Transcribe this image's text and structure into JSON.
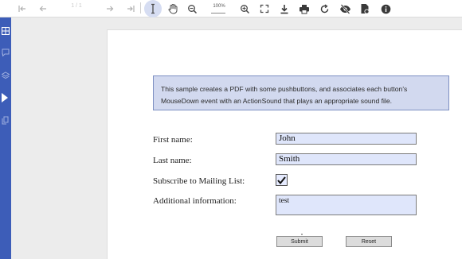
{
  "toolbar": {
    "page_number": "1 / 1",
    "zoom_level": "100%",
    "active_tool": "text-select",
    "icons": [
      "first-page-icon",
      "previous-page-icon",
      "next-page-icon",
      "last-page-icon",
      "text-select-icon",
      "pan-hand-icon",
      "zoom-out-icon",
      "zoom-in-icon",
      "fit-page-icon",
      "download-icon",
      "print-icon",
      "rotate-icon",
      "hide-annotations-icon",
      "file-info-icon",
      "info-icon"
    ]
  },
  "sidebar": {
    "accent_color": "#3d5db8",
    "icons": [
      "thumbnails-icon",
      "comments-icon",
      "layers-icon",
      "bookmark-icon",
      "attachments-icon"
    ]
  },
  "form": {
    "note": "This sample creates a PDF with some pushbuttons, and associates each button's MouseDown event with an ActionSound that plays an appropriate sound file.",
    "first_name_label": "First name:",
    "first_name_value": "John",
    "last_name_label": "Last name:",
    "last_name_value": "Smith",
    "subscribe_label": "Subscribe to Mailing List:",
    "subscribe_checked": true,
    "additional_label": "Additional information:",
    "additional_value": "test",
    "submit_label": "Submit",
    "reset_label": "Reset"
  }
}
